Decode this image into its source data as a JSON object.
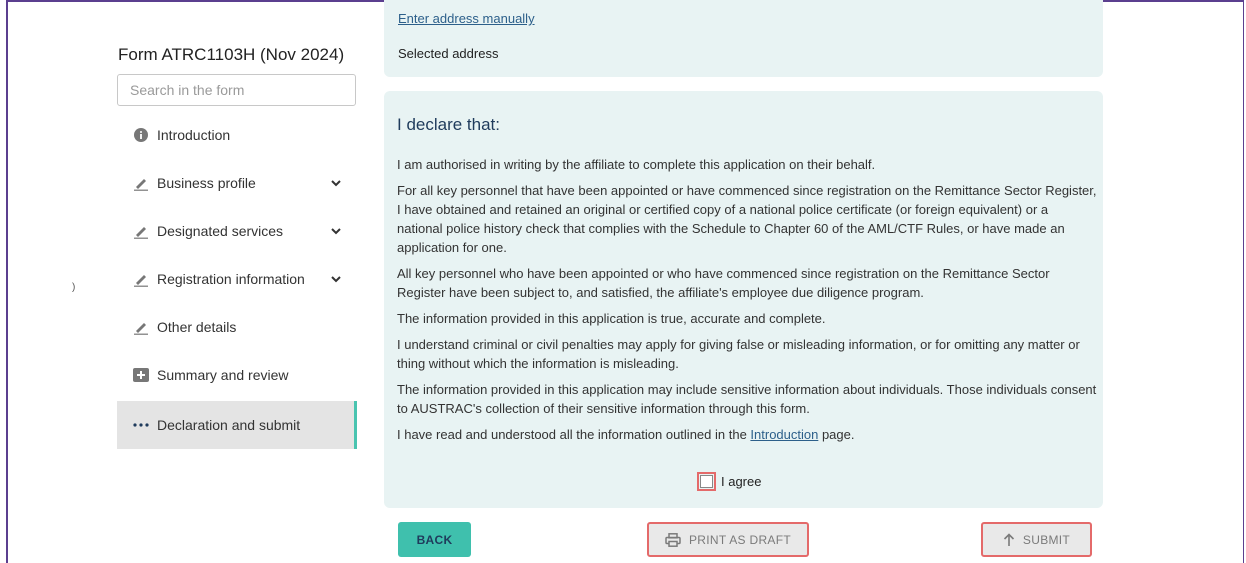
{
  "sidebar": {
    "form_title": "Form ATRC1103H (Nov 2024)",
    "search_placeholder": "Search in the form",
    "items": [
      {
        "label": "Introduction",
        "icon": "info-icon"
      },
      {
        "label": "Business profile",
        "icon": "pencil-icon",
        "expandable": true
      },
      {
        "label": "Designated services",
        "icon": "pencil-icon",
        "expandable": true
      },
      {
        "label": "Registration information",
        "icon": "pencil-icon",
        "expandable": true
      },
      {
        "label": "Other details",
        "icon": "pencil-icon"
      },
      {
        "label": "Summary and review",
        "icon": "plus-box-icon"
      },
      {
        "label": "Declaration and submit",
        "icon": "ellipsis-icon",
        "active": true
      }
    ],
    "side_marker": ")"
  },
  "address": {
    "manual_link": "Enter address manually",
    "selected_label": "Selected address"
  },
  "declaration": {
    "heading": "I declare that:",
    "p1": "I am authorised in writing by the affiliate to complete this application on their behalf.",
    "p2": "For all key personnel that have been appointed or have commenced since registration on the Remittance Sector Register, I have obtained and retained an original or certified copy of a national police certificate (or foreign equivalent) or a national police history check that complies with the Schedule to Chapter 60 of the AML/CTF Rules, or have made an application for one.",
    "p3": "All key personnel who have been appointed or who have commenced since registration on the Remittance Sector Register have been subject to, and satisfied, the affiliate's employee due diligence program.",
    "p4": "The information provided in this application is true, accurate and complete.",
    "p5": "I understand criminal or civil penalties may apply for giving false or misleading information, or for omitting any matter or thing without which the information is misleading.",
    "p6": "The information provided in this application may include sensitive information about individuals. Those individuals consent to AUSTRAC's collection of their sensitive information through this form.",
    "p7_before": "I have read and understood all the information outlined in the ",
    "p7_link": "Introduction",
    "p7_after": " page.",
    "agree_label": "I agree"
  },
  "buttons": {
    "back": "BACK",
    "print": "PRINT AS DRAFT",
    "submit": "SUBMIT"
  },
  "colors": {
    "accent": "#3fc0ad",
    "panel_bg": "#e8f3f3",
    "highlight": "#e46a6a",
    "heading": "#1f3b5c"
  }
}
